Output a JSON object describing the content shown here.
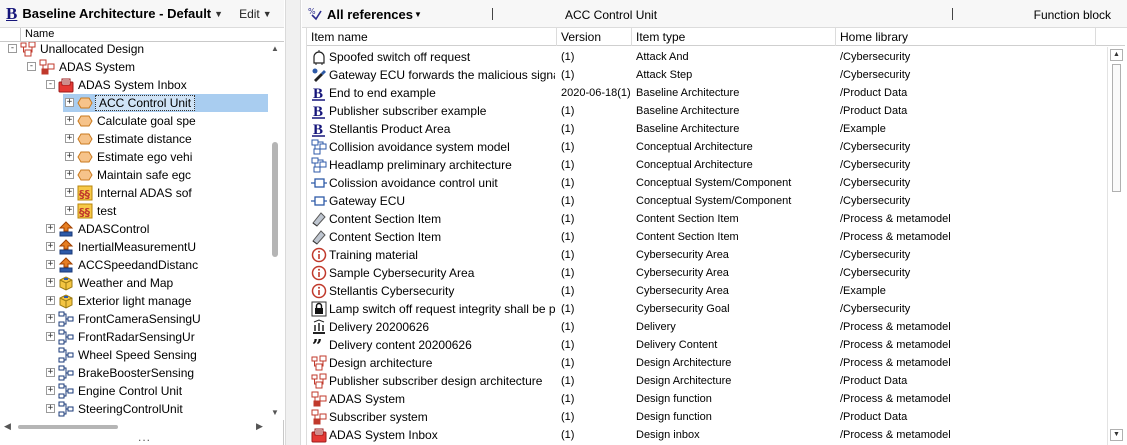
{
  "left": {
    "logo_letter": "B",
    "title": "Baseline Architecture - Default",
    "edit_label": "Edit",
    "column_header": "Name",
    "tree": [
      {
        "label": "Unallocated Design",
        "depth": 4,
        "expand": "-",
        "icon": "design-architecture-icon"
      },
      {
        "label": "ADAS System",
        "depth": 5,
        "expand": "-",
        "icon": "design-function-icon"
      },
      {
        "label": "ADAS System Inbox",
        "depth": 6,
        "expand": "-",
        "icon": "design-inbox-icon"
      },
      {
        "label": "ACC Control Unit",
        "depth": 7,
        "expand": "+",
        "icon": "hexagon-function-icon",
        "selected": true
      },
      {
        "label": "Calculate goal spe",
        "depth": 7,
        "expand": "+",
        "icon": "hexagon-function-icon"
      },
      {
        "label": "Estimate distance",
        "depth": 7,
        "expand": "+",
        "icon": "hexagon-function-icon"
      },
      {
        "label": "Estimate ego vehi",
        "depth": 7,
        "expand": "+",
        "icon": "hexagon-function-icon"
      },
      {
        "label": "Maintain safe egc",
        "depth": 7,
        "expand": "+",
        "icon": "hexagon-function-icon"
      },
      {
        "label": "Internal ADAS sof",
        "depth": 7,
        "expand": "+",
        "icon": "section-paragraph-icon"
      },
      {
        "label": "test",
        "depth": 7,
        "expand": "+",
        "icon": "section-paragraph-icon"
      },
      {
        "label": "ADASControl",
        "depth": 6,
        "expand": "+",
        "icon": "component-arrow-icon"
      },
      {
        "label": "InertialMeasurementU",
        "depth": 6,
        "expand": "+",
        "icon": "component-arrow-icon"
      },
      {
        "label": "ACCSpeedandDistanc",
        "depth": 6,
        "expand": "+",
        "icon": "component-arrow-icon"
      },
      {
        "label": "Weather and Map",
        "depth": 6,
        "expand": "+",
        "icon": "package-box-icon"
      },
      {
        "label": "Exterior light manage",
        "depth": 6,
        "expand": "+",
        "icon": "package-box-icon"
      },
      {
        "label": "FrontCameraSensingU",
        "depth": 6,
        "expand": "+",
        "icon": "structure-network-icon"
      },
      {
        "label": "FrontRadarSensingUr",
        "depth": 6,
        "expand": "+",
        "icon": "structure-network-icon"
      },
      {
        "label": "Wheel Speed Sensing",
        "depth": 6,
        "expand": "",
        "icon": "structure-network-icon"
      },
      {
        "label": "BrakeBoosterSensing",
        "depth": 6,
        "expand": "+",
        "icon": "structure-network-icon"
      },
      {
        "label": "Engine Control Unit",
        "depth": 6,
        "expand": "+",
        "icon": "structure-network-icon"
      },
      {
        "label": "SteeringControlUnit",
        "depth": 6,
        "expand": "+",
        "icon": "structure-network-icon"
      }
    ],
    "more_dots": "..."
  },
  "right": {
    "title": "All references",
    "element_name": "ACC Control Unit",
    "element_type": "Function block",
    "columns": [
      "Item name",
      "Version",
      "Item type",
      "Home library"
    ],
    "rows": [
      {
        "icon": "attack-and-icon",
        "name": "Spoofed switch off request",
        "version": "(1)",
        "type": "Attack And",
        "library": "/Cybersecurity"
      },
      {
        "icon": "attack-step-icon",
        "name": "Gateway ECU forwards the malicious signal",
        "version": "(1)",
        "type": "Attack Step",
        "library": "/Cybersecurity"
      },
      {
        "icon": "baseline-b-icon",
        "name": "End to end example",
        "version": "2020-06-18(1)",
        "type": "Baseline Architecture",
        "library": "/Product Data"
      },
      {
        "icon": "baseline-b-icon",
        "name": "Publisher subscriber example",
        "version": "(1)",
        "type": "Baseline Architecture",
        "library": "/Product Data"
      },
      {
        "icon": "baseline-b-icon",
        "name": "Stellantis Product Area",
        "version": "(1)",
        "type": "Baseline Architecture",
        "library": "/Example"
      },
      {
        "icon": "conceptual-architecture-icon",
        "name": "Collision avoidance system model",
        "version": "(1)",
        "type": "Conceptual Architecture",
        "library": "/Cybersecurity"
      },
      {
        "icon": "conceptual-architecture-icon",
        "name": "Headlamp preliminary architecture",
        "version": "(1)",
        "type": "Conceptual Architecture",
        "library": "/Cybersecurity"
      },
      {
        "icon": "conceptual-component-icon",
        "name": "Colission avoidance control unit",
        "version": "(1)",
        "type": "Conceptual System/Component",
        "library": "/Cybersecurity"
      },
      {
        "icon": "conceptual-component-icon",
        "name": "Gateway ECU",
        "version": "(1)",
        "type": "Conceptual System/Component",
        "library": "/Cybersecurity"
      },
      {
        "icon": "content-section-icon",
        "name": "Content Section Item",
        "version": "(1)",
        "type": "Content Section Item",
        "library": "/Process & metamodel"
      },
      {
        "icon": "content-section-icon",
        "name": "Content Section Item",
        "version": "(1)",
        "type": "Content Section Item",
        "library": "/Process & metamodel"
      },
      {
        "icon": "cybersecurity-area-icon",
        "name": "Training material",
        "version": "(1)",
        "type": "Cybersecurity Area",
        "library": "/Cybersecurity"
      },
      {
        "icon": "cybersecurity-area-icon",
        "name": "Sample Cybersecurity Area",
        "version": "(1)",
        "type": "Cybersecurity Area",
        "library": "/Cybersecurity"
      },
      {
        "icon": "cybersecurity-area-icon",
        "name": "Stellantis Cybersecurity",
        "version": "(1)",
        "type": "Cybersecurity Area",
        "library": "/Example"
      },
      {
        "icon": "lock-goal-icon",
        "name": "Lamp switch off request integrity shall be pr",
        "version": "(1)",
        "type": "Cybersecurity Goal",
        "library": "/Cybersecurity"
      },
      {
        "icon": "delivery-icon",
        "name": "Delivery 20200626",
        "version": "(1)",
        "type": "Delivery",
        "library": "/Process & metamodel"
      },
      {
        "icon": "quote-icon",
        "name": "Delivery content 20200626",
        "version": "(1)",
        "type": "Delivery Content",
        "library": "/Process & metamodel"
      },
      {
        "icon": "design-architecture-icon",
        "name": "Design architecture",
        "version": "(1)",
        "type": "Design Architecture",
        "library": "/Process & metamodel"
      },
      {
        "icon": "design-architecture-icon",
        "name": "Publisher subscriber design architecture",
        "version": "(1)",
        "type": "Design Architecture",
        "library": "/Product Data"
      },
      {
        "icon": "design-function-icon",
        "name": "ADAS System",
        "version": "(1)",
        "type": "Design function",
        "library": "/Process & metamodel"
      },
      {
        "icon": "design-function-icon",
        "name": "Subscriber system",
        "version": "(1)",
        "type": "Design function",
        "library": "/Product Data"
      },
      {
        "icon": "design-inbox-icon",
        "name": "ADAS System Inbox",
        "version": "(1)",
        "type": "Design inbox",
        "library": "/Process & metamodel"
      }
    ]
  }
}
